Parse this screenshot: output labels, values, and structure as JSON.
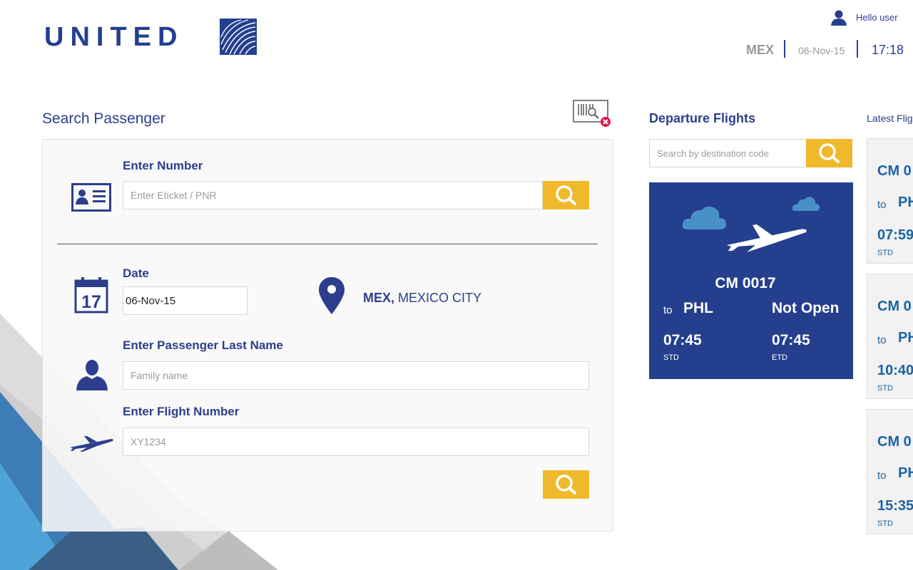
{
  "header": {
    "logo_text": "UNITED",
    "user_greeting": "Hello user",
    "station_code": "MEX",
    "date": "06-Nov-15",
    "time": "17:18"
  },
  "search_passenger": {
    "title": "Search Passenger",
    "enter_number_label": "Enter Number",
    "eticket_placeholder": "Enter Eticket / PNR",
    "date_label": "Date",
    "date_value": "06-Nov-15",
    "calendar_day": "17",
    "location_code": "MEX,",
    "location_city": "MEXICO CITY",
    "last_name_label": "Enter Passenger Last Name",
    "last_name_placeholder": "Family name",
    "flight_number_label": "Enter Flight Number",
    "flight_number_placeholder": "XY1234"
  },
  "departure": {
    "title": "Departure Flights",
    "search_placeholder": "Search by destination code",
    "card": {
      "flight": "CM 0017",
      "to_label": "to",
      "destination": "PHL",
      "status": "Not Open",
      "std_time": "07:45",
      "std_label": "STD",
      "etd_time": "07:45",
      "etd_label": "ETD"
    }
  },
  "latest": {
    "title": "Latest Flights",
    "cards": [
      {
        "flight": "CM 0",
        "to": "to",
        "dest": "PH",
        "time": "07:59",
        "label": "STD"
      },
      {
        "flight": "CM 0",
        "to": "to",
        "dest": "PH",
        "time": "10:40",
        "label": "STD"
      },
      {
        "flight": "CM 0",
        "to": "to",
        "dest": "PH",
        "time": "15:35",
        "label": "STD"
      }
    ]
  },
  "colors": {
    "brand_blue": "#253f8f",
    "accent_yellow": "#f0b92c",
    "latest_blue": "#1c64a6"
  }
}
